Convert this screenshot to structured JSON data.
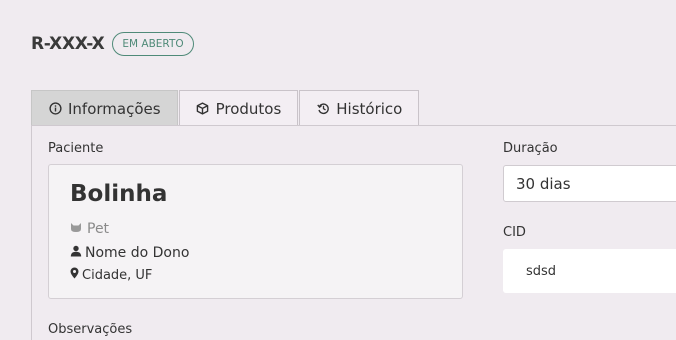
{
  "header": {
    "record_code": "R-XXX-X",
    "status": "EM ABERTO"
  },
  "tabs": [
    {
      "label": "Informações",
      "icon": "info-circle-icon",
      "active": true
    },
    {
      "label": "Produtos",
      "icon": "box-icon",
      "active": false
    },
    {
      "label": "Histórico",
      "icon": "history-icon",
      "active": false
    }
  ],
  "patient": {
    "section_label": "Paciente",
    "name": "Bolinha",
    "species": "Pet",
    "species_icon": "cat-icon",
    "owner": "Nome do Dono",
    "owner_icon": "person-icon",
    "location": "Cidade, UF",
    "location_icon": "map-pin-icon"
  },
  "duration": {
    "label": "Duração",
    "value": "30 dias"
  },
  "cid": {
    "label": "CID",
    "value": "sdsd"
  },
  "observations": {
    "label": "Observações"
  },
  "colors": {
    "background": "#f0ebf0",
    "badge_accent": "#4f8a78",
    "active_tab": "#d5d5d5"
  }
}
